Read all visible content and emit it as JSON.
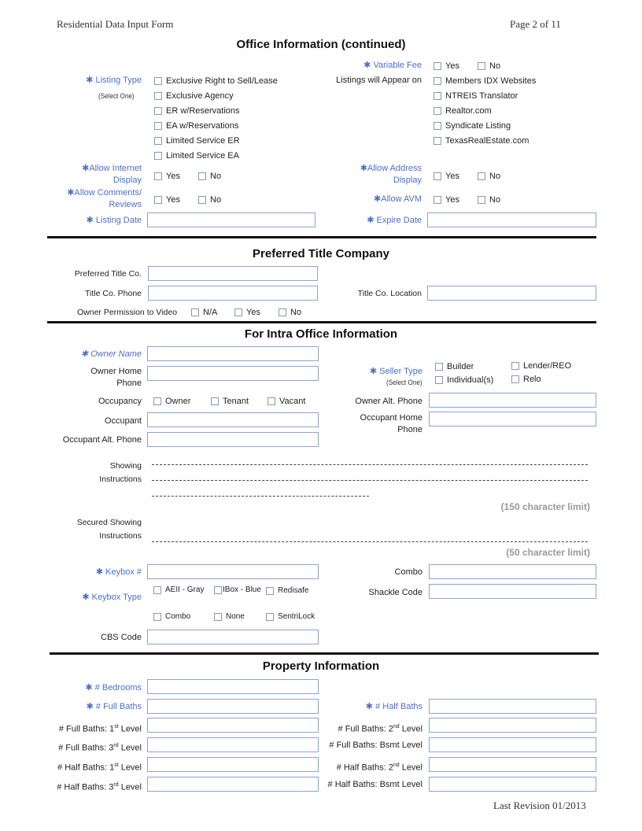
{
  "header": {
    "form_title": "Residential Data Input Form",
    "page": "Page 2 of 11"
  },
  "footer": {
    "revision": "Last Revision 01/2013"
  },
  "office": {
    "title": "Office Information (continued)",
    "variable_fee": {
      "label": "✱ Variable Fee",
      "options": [
        "Yes",
        "No"
      ]
    },
    "listing_type": {
      "label": "✱ Listing Type",
      "sub": "(Select One)",
      "options": [
        "Exclusive Right to Sell/Lease",
        "Exclusive Agency",
        "ER w/Reservations",
        "EA w/Reservations",
        "Limited Service ER",
        "Limited Service EA"
      ]
    },
    "listings_appear": {
      "label": "Listings will Appear on",
      "options": [
        "Members IDX Websites",
        "NTREIS Translator",
        "Realtor.com",
        "Syndicate Listing",
        "TexasRealEstate.com"
      ]
    },
    "allow_internet": {
      "label1": "✱Allow Internet",
      "label2": "Display",
      "options": [
        "Yes",
        "No"
      ]
    },
    "allow_address": {
      "label1": "✱Allow Address",
      "label2": "Display",
      "options": [
        "Yes",
        "No"
      ]
    },
    "allow_comments": {
      "label1": "✱Allow Comments/",
      "label2": "Reviews",
      "options": [
        "Yes",
        "No"
      ]
    },
    "allow_avm": {
      "label": "✱Allow AVM",
      "options": [
        "Yes",
        "No"
      ]
    },
    "listing_date": {
      "label": "✱ Listing Date",
      "value": ""
    },
    "expire_date": {
      "label": "✱ Expire Date",
      "value": ""
    }
  },
  "title_company": {
    "title": "Preferred Title Company",
    "preferred": {
      "label": "Preferred Title Co.",
      "value": ""
    },
    "phone": {
      "label": "Title Co. Phone",
      "value": ""
    },
    "location": {
      "label": "Title Co. Location",
      "value": ""
    },
    "video": {
      "label": "Owner Permission to Video",
      "options": [
        "N/A",
        "Yes",
        "No"
      ]
    }
  },
  "intra": {
    "title": "For Intra Office Information",
    "owner_name": {
      "label": "✱ Owner Name",
      "value": ""
    },
    "owner_home_phone": {
      "label1": "Owner Home",
      "label2": "Phone",
      "value": ""
    },
    "seller_type": {
      "label": "✱ Seller Type",
      "sub": "(Select One)",
      "options": [
        "Builder",
        "Individual(s)",
        "Lender/REO",
        "Relo"
      ]
    },
    "occupancy": {
      "label": "Occupancy",
      "options": [
        "Owner",
        "Tenant",
        "Vacant"
      ]
    },
    "owner_alt_phone": {
      "label": "Owner Alt. Phone",
      "value": ""
    },
    "occupant": {
      "label": "Occupant",
      "value": ""
    },
    "occupant_home_phone": {
      "label1": "Occupant Home",
      "label2": "Phone",
      "value": ""
    },
    "occupant_alt_phone": {
      "label": "Occupant Alt. Phone",
      "value": ""
    },
    "showing": {
      "label1": "Showing",
      "label2": "Instructions",
      "limit": "(150 character limit)"
    },
    "secured_showing": {
      "label1": "Secured Showing",
      "label2": "Instructions",
      "limit": "(50 character limit)"
    },
    "keybox_num": {
      "label": "✱ Keybox #",
      "value": ""
    },
    "combo": {
      "label": "Combo",
      "value": ""
    },
    "keybox_type": {
      "label": "✱ Keybox Type",
      "options": [
        "AEII - Gray",
        "IBox - Blue",
        "Redisafe",
        "Combo",
        "None",
        "SentriLock"
      ]
    },
    "shackle_code": {
      "label": "Shackle Code",
      "value": ""
    },
    "cbs_code": {
      "label": "CBS Code",
      "value": ""
    }
  },
  "property": {
    "title": "Property Information",
    "bedrooms": {
      "label": "✱ # Bedrooms",
      "value": ""
    },
    "full_baths": {
      "label": "✱ # Full Baths",
      "value": ""
    },
    "half_baths": {
      "label": "✱ # Half Baths",
      "value": ""
    },
    "full_1": {
      "pre": "# Full Baths: 1",
      "sup": "st",
      "post": " Level",
      "value": ""
    },
    "full_2": {
      "pre": "# Full Baths: 2",
      "sup": "nd",
      "post": " Level",
      "value": ""
    },
    "full_3": {
      "pre": "# Full Baths: 3",
      "sup": "rd",
      "post": " Level",
      "value": ""
    },
    "full_bsmt": {
      "label": "# Full Baths: Bsmt Level",
      "value": ""
    },
    "half_1": {
      "pre": "# Half Baths: 1",
      "sup": "st",
      "post": " Level",
      "value": ""
    },
    "half_2": {
      "pre": "# Half Baths: 2",
      "sup": "nd",
      "post": " Level",
      "value": ""
    },
    "half_3": {
      "pre": "# Half Baths: 3",
      "sup": "rd",
      "post": " Level",
      "value": ""
    },
    "half_bsmt": {
      "label": "# Half Baths: Bsmt Level",
      "value": ""
    }
  }
}
